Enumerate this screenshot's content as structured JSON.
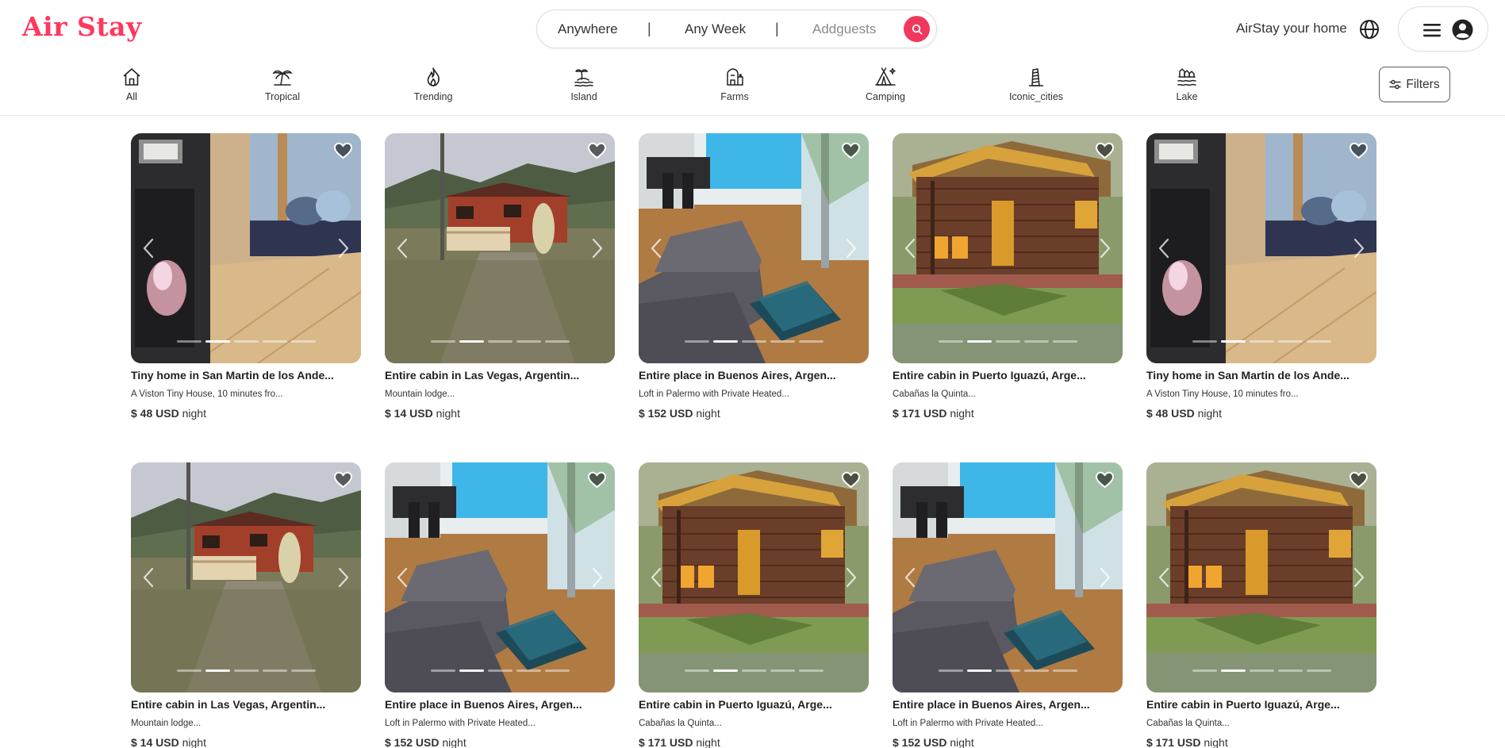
{
  "header": {
    "logo": "Air Stay",
    "search": {
      "where": "Anywhere",
      "separator": "|",
      "when": "Any Week",
      "guests": "Addguests"
    },
    "host_link": "AirStay your home"
  },
  "categories": [
    {
      "label": "All",
      "icon": "house-icon"
    },
    {
      "label": "Tropical",
      "icon": "palm-tree-icon"
    },
    {
      "label": "Trending",
      "icon": "flame-icon"
    },
    {
      "label": "Island",
      "icon": "island-icon"
    },
    {
      "label": "Farms",
      "icon": "barn-icon"
    },
    {
      "label": "Camping",
      "icon": "tent-icon"
    },
    {
      "label": "Iconic_cities",
      "icon": "tower-icon"
    },
    {
      "label": "Lake",
      "icon": "lake-icon"
    }
  ],
  "filters_label": "Filters",
  "colors": {
    "brand": "#ff385c",
    "search_button": "#f0385d"
  },
  "listings": [
    {
      "title": "Tiny home in San Martin de los Ande...",
      "desc": "A Viston Tiny House, 10 minutes fro...",
      "price": "$ 48 USD",
      "unit": "night",
      "scene": "stove"
    },
    {
      "title": "Entire cabin in Las Vegas, Argentin...",
      "desc": "Mountain lodge...",
      "price": "$ 14 USD",
      "unit": "night",
      "scene": "mountain"
    },
    {
      "title": "Entire place in Buenos Aires, Argen...",
      "desc": "Loft in Palermo with Private Heated...",
      "price": "$ 152 USD",
      "unit": "night",
      "scene": "loft"
    },
    {
      "title": "Entire cabin in Puerto Iguazú, Arge...",
      "desc": "Cabañas la Quinta...",
      "price": "$ 171 USD",
      "unit": "night",
      "scene": "cabin"
    },
    {
      "title": "Tiny home in San Martin de los Ande...",
      "desc": "A Viston Tiny House, 10 minutes fro...",
      "price": "$ 48 USD",
      "unit": "night",
      "scene": "stove"
    },
    {
      "title": "Entire cabin in Las Vegas, Argentin...",
      "desc": "Mountain lodge...",
      "price": "$ 14 USD",
      "unit": "night",
      "scene": "mountain"
    },
    {
      "title": "Entire place in Buenos Aires, Argen...",
      "desc": "Loft in Palermo with Private Heated...",
      "price": "$ 152 USD",
      "unit": "night",
      "scene": "loft"
    },
    {
      "title": "Entire cabin in Puerto Iguazú, Arge...",
      "desc": "Cabañas la Quinta...",
      "price": "$ 171 USD",
      "unit": "night",
      "scene": "cabin"
    },
    {
      "title": "Entire place in Buenos Aires, Argen...",
      "desc": "Loft in Palermo with Private Heated...",
      "price": "$ 152 USD",
      "unit": "night",
      "scene": "loft"
    },
    {
      "title": "Entire cabin in Puerto Iguazú, Arge...",
      "desc": "Cabañas la Quinta...",
      "price": "$ 171 USD",
      "unit": "night",
      "scene": "cabin"
    }
  ]
}
